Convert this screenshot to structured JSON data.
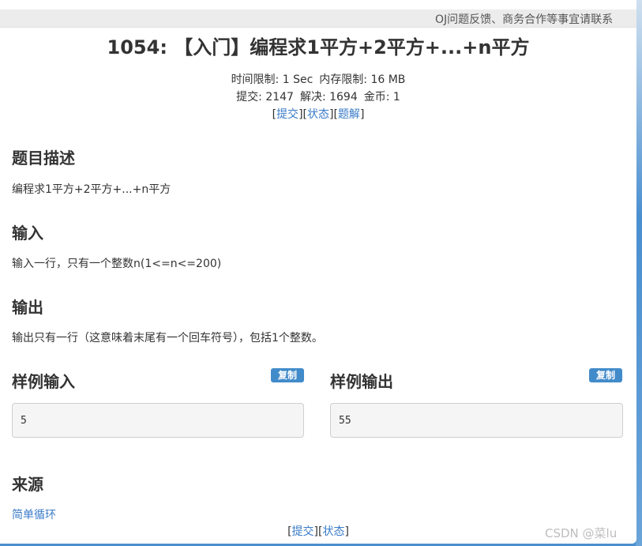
{
  "banner": {
    "text": "OJ问题反馈、商务合作等事宜请联系"
  },
  "problem": {
    "title": "1054: 【入门】编程求1平方+2平方+...+n平方",
    "time_limit": "时间限制: 1 Sec",
    "memory_limit": "内存限制: 16 MB",
    "submissions": "提交: 2147",
    "solved": "解决: 1694",
    "coins": "金币: 1"
  },
  "top_links": {
    "submit": "提交",
    "status": "状态",
    "solution": "题解"
  },
  "sections": {
    "description_heading": "题目描述",
    "description_text": "编程求1平方+2平方+...+n平方",
    "input_heading": "输入",
    "input_text": "输入一行，只有一个整数n(1<=n<=200)",
    "output_heading": "输出",
    "output_text": "输出只有一行（这意味着末尾有一个回车符号），包括1个整数。",
    "sample_input_heading": "样例输入",
    "sample_output_heading": "样例输出",
    "copy_label": "复制",
    "sample_input": "5",
    "sample_output": "55",
    "source_heading": "来源",
    "source_link": "简单循环"
  },
  "bottom_links": {
    "submit": "提交",
    "status": "状态"
  },
  "watermark": "CSDN @菜lu",
  "colors": {
    "link": "#3a7bc8",
    "copy_button": "#428bca",
    "background_blue": "#4a8fd0"
  }
}
